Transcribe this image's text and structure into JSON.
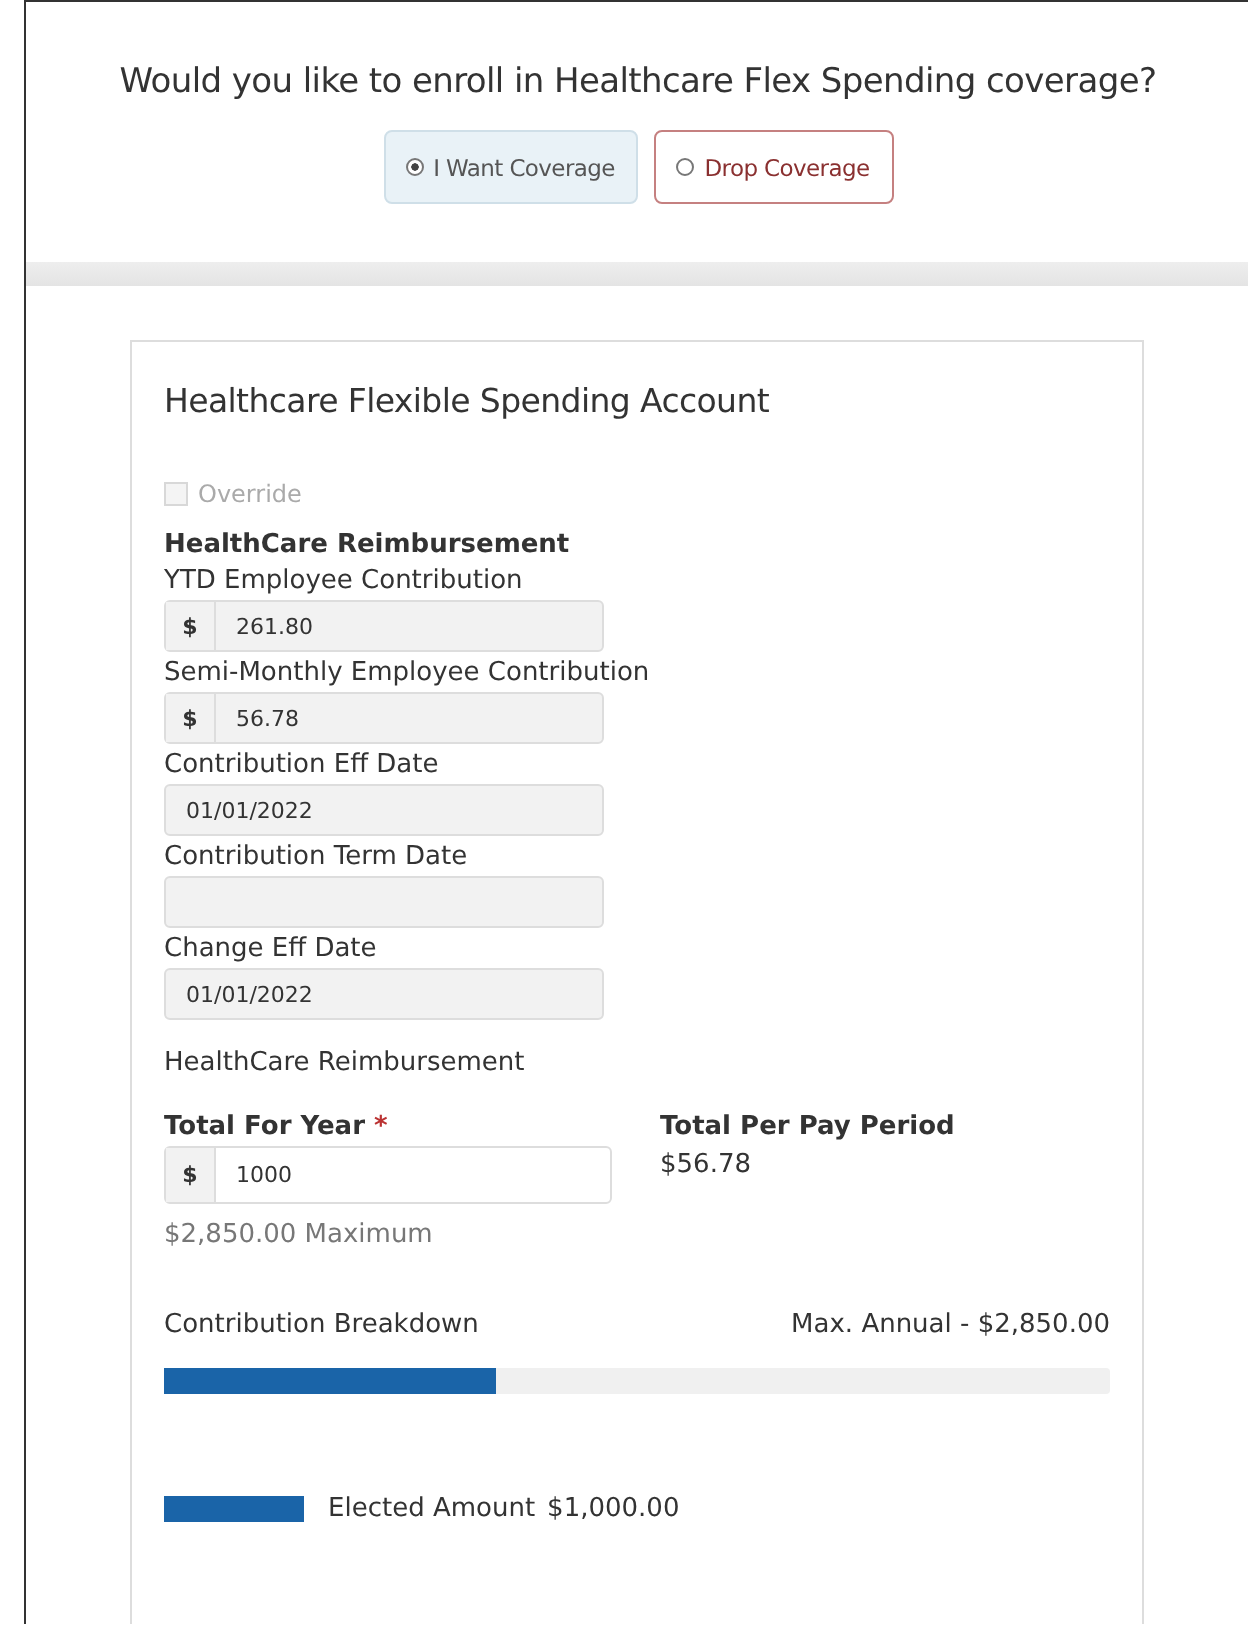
{
  "question": "Would you like to enroll in Healthcare Flex Spending coverage?",
  "coverage_options": [
    {
      "label": "I Want Coverage",
      "selected": true
    },
    {
      "label": "Drop Coverage",
      "selected": false
    }
  ],
  "card": {
    "title": "Healthcare Flexible Spending Account",
    "override": {
      "label": "Override",
      "checked": false,
      "disabled": true
    },
    "section_heading": "HealthCare Reimbursement",
    "fields": [
      {
        "label": "YTD Employee Contribution",
        "prefix": "$",
        "value": "261.80"
      },
      {
        "label": "Semi-Monthly  Employee Contribution",
        "prefix": "$",
        "value": "56.78"
      },
      {
        "label": "Contribution Eff Date",
        "value": "01/01/2022"
      },
      {
        "label": "Contribution Term Date"
      },
      {
        "label": "Change Eff Date",
        "value": "01/01/2022"
      }
    ],
    "subheading": "HealthCare Reimbursement",
    "total_for_year": {
      "label": "Total For Year",
      "required_mark": "*",
      "prefix": "$",
      "value": "1000",
      "hint": "$2,850.00 Maximum"
    },
    "total_per_pay_period": {
      "label": "Total Per Pay Period",
      "value": "$56.78"
    },
    "breakdown": {
      "label": "Contribution Breakdown",
      "max_text": "Max. Annual - $2,850.00",
      "level": 0.351
    },
    "legend": {
      "label": "Elected Amount",
      "value": "$1,000.00"
    }
  }
}
